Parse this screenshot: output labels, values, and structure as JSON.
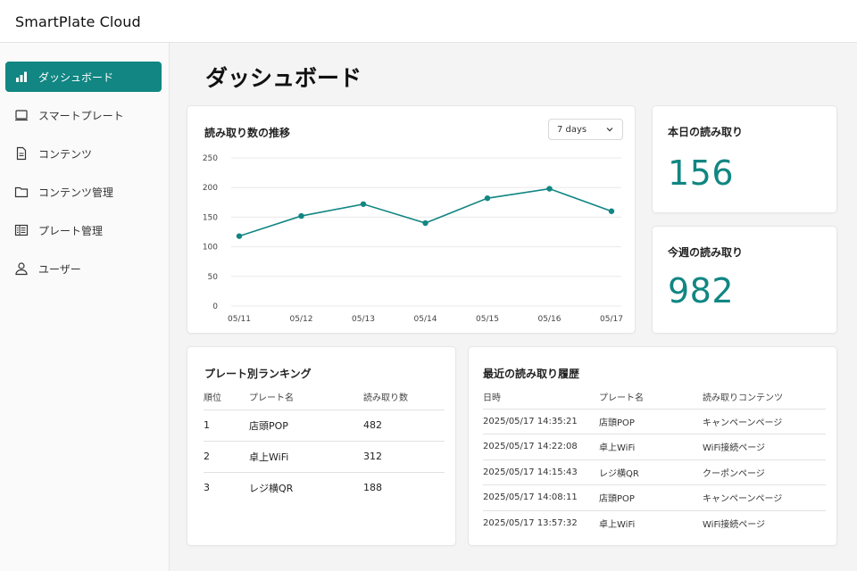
{
  "app": {
    "title": "SmartPlate Cloud"
  },
  "sidebar": {
    "items": [
      {
        "label": "ダッシュボード",
        "icon": "bar-chart-icon",
        "active": true
      },
      {
        "label": "スマートプレート",
        "icon": "plate-icon",
        "active": false
      },
      {
        "label": "コンテンツ",
        "icon": "document-icon",
        "active": false
      },
      {
        "label": "コンテンツ管理",
        "icon": "folder-icon",
        "active": false
      },
      {
        "label": "プレート管理",
        "icon": "list-icon",
        "active": false
      },
      {
        "label": "ユーザー",
        "icon": "user-icon",
        "active": false
      }
    ]
  },
  "page": {
    "title": "ダッシュボード"
  },
  "trend": {
    "title": "読み取り数の推移",
    "range_selected": "7 days"
  },
  "chart_data": {
    "type": "line",
    "title": "読み取り数の推移",
    "categories": [
      "05/11",
      "05/12",
      "05/13",
      "05/14",
      "05/15",
      "05/16",
      "05/17"
    ],
    "series": [
      {
        "values": [
          118,
          152,
          172,
          140,
          182,
          198,
          160
        ]
      }
    ],
    "y_ticks": [
      0,
      50,
      100,
      150,
      200,
      250
    ],
    "ylim": [
      0,
      250
    ],
    "grid": true,
    "color": "#118682"
  },
  "stats": {
    "today": {
      "label": "本日の読み取り",
      "value": "156"
    },
    "week": {
      "label": "今週の読み取り",
      "value": "982"
    }
  },
  "ranking": {
    "title": "プレート別ランキング",
    "headers": [
      "順位",
      "プレート名",
      "読み取り数"
    ],
    "rows": [
      [
        "1",
        "店頭POP",
        "482"
      ],
      [
        "2",
        "卓上WiFi",
        "312"
      ],
      [
        "3",
        "レジ横QR",
        "188"
      ]
    ]
  },
  "history": {
    "title": "最近の読み取り履歴",
    "headers": [
      "日時",
      "プレート名",
      "読み取りコンテンツ"
    ],
    "rows": [
      [
        "2025/05/17 14:35:21",
        "店頭POP",
        "キャンペーンページ"
      ],
      [
        "2025/05/17 14:22:08",
        "卓上WiFi",
        "WiFi接続ページ"
      ],
      [
        "2025/05/17 14:15:43",
        "レジ横QR",
        "クーポンページ"
      ],
      [
        "2025/05/17 14:08:11",
        "店頭POP",
        "キャンペーンページ"
      ],
      [
        "2025/05/17 13:57:32",
        "卓上WiFi",
        "WiFi接続ページ"
      ]
    ]
  },
  "colors": {
    "accent": "#118682",
    "background": "#f4f4f4",
    "card": "#ffffff"
  }
}
